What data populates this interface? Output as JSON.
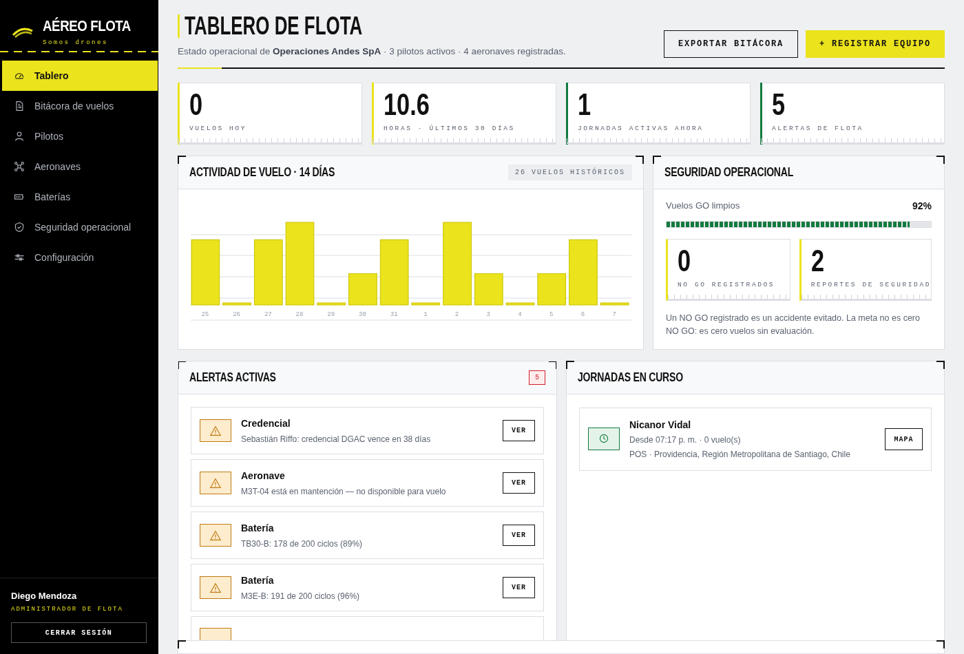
{
  "sidebar": {
    "brand": "AÉREO FLOTA",
    "tagline": "Somos drones",
    "items": [
      {
        "label": "Tablero",
        "selected": true
      },
      {
        "label": "Bitácora de vuelos",
        "selected": false
      },
      {
        "label": "Pilotos",
        "selected": false
      },
      {
        "label": "Aeronaves",
        "selected": false
      },
      {
        "label": "Baterías",
        "selected": false
      },
      {
        "label": "Seguridad operacional",
        "selected": false
      },
      {
        "label": "Configuración",
        "selected": false
      }
    ],
    "user": {
      "name": "Diego Mendoza",
      "role": "ADMINISTRADOR DE FLOTA"
    },
    "logout": "CERRAR SESIÓN"
  },
  "header": {
    "title": "TABLERO DE FLOTA",
    "subtitle": "Estado operacional de **Operaciones Andes SpA** · 3 pilotos activos · 4 aeronaves registradas.",
    "buttons": [
      {
        "label": "EXPORTAR BITÁCORA",
        "kind": "outline"
      },
      {
        "label": "+ REGISTRAR EQUIPO",
        "kind": "primary"
      }
    ]
  },
  "stats": [
    {
      "value": "0",
      "label": "VUELOS HOY",
      "color": "#ebe31c"
    },
    {
      "value": "10.6",
      "label": "HORAS · ÚLTIMOS 30 DÍAS",
      "color": "#ebe31c"
    },
    {
      "value": "1",
      "label": "JORNADAS ACTIVAS AHORA",
      "color": "#127a3e"
    },
    {
      "value": "5",
      "label": "ALERTAS DE FLOTA",
      "color": "#127a3e"
    }
  ],
  "activity": {
    "title": "ACTIVIDAD DE VUELO · 14 DÍAS",
    "badge": "26 VUELOS HISTÓRICOS",
    "day_labels": [
      "25",
      "26",
      "27",
      "28",
      "29",
      "30",
      "31",
      "1",
      "2",
      "3",
      "4",
      "5",
      "6",
      "7"
    ]
  },
  "safety": {
    "title": "SEGURIDAD OPERACIONAL",
    "meter": {
      "label": "Vuelos GO limpios",
      "reading": "92%",
      "level": 0.92
    },
    "stats": [
      {
        "value": "0",
        "label": "NO GO REGISTRADOS"
      },
      {
        "value": "2",
        "label": "REPORTES DE SEGURIDAD"
      }
    ],
    "note": "Un NO GO registrado es un accidente evitado. La meta no es cero NO GO: es cero vuelos sin evaluación."
  },
  "alerts": {
    "title": "ALERTAS ACTIVAS",
    "count": "5",
    "items": [
      {
        "kind": "alert",
        "title": "Credencial",
        "detail": "Sebastián Riffo: credencial DGAC vence en 38 días",
        "action": "VER"
      },
      {
        "kind": "alert",
        "title": "Aeronave",
        "detail": "M3T-04 está en mantención — no disponible para vuelo",
        "action": "VER"
      },
      {
        "kind": "alert",
        "title": "Batería",
        "detail": "TB30-B: 178 de 200 ciclos (89%)",
        "action": "VER"
      },
      {
        "kind": "alert",
        "title": "Batería",
        "detail": "M3E-B: 191 de 200 ciclos (96%)",
        "action": "VER"
      },
      {
        "kind": "partial"
      }
    ]
  },
  "shifts": {
    "title": "JORNADAS EN CURSO",
    "items": [
      {
        "name": "Nicanor Vidal",
        "since": "Desde 07:17 p. m. · 0 vuelo(s)",
        "position": "POS · Providencia, Región Metropolitana de Santiago, Chile",
        "action": "MAPA"
      }
    ]
  }
}
